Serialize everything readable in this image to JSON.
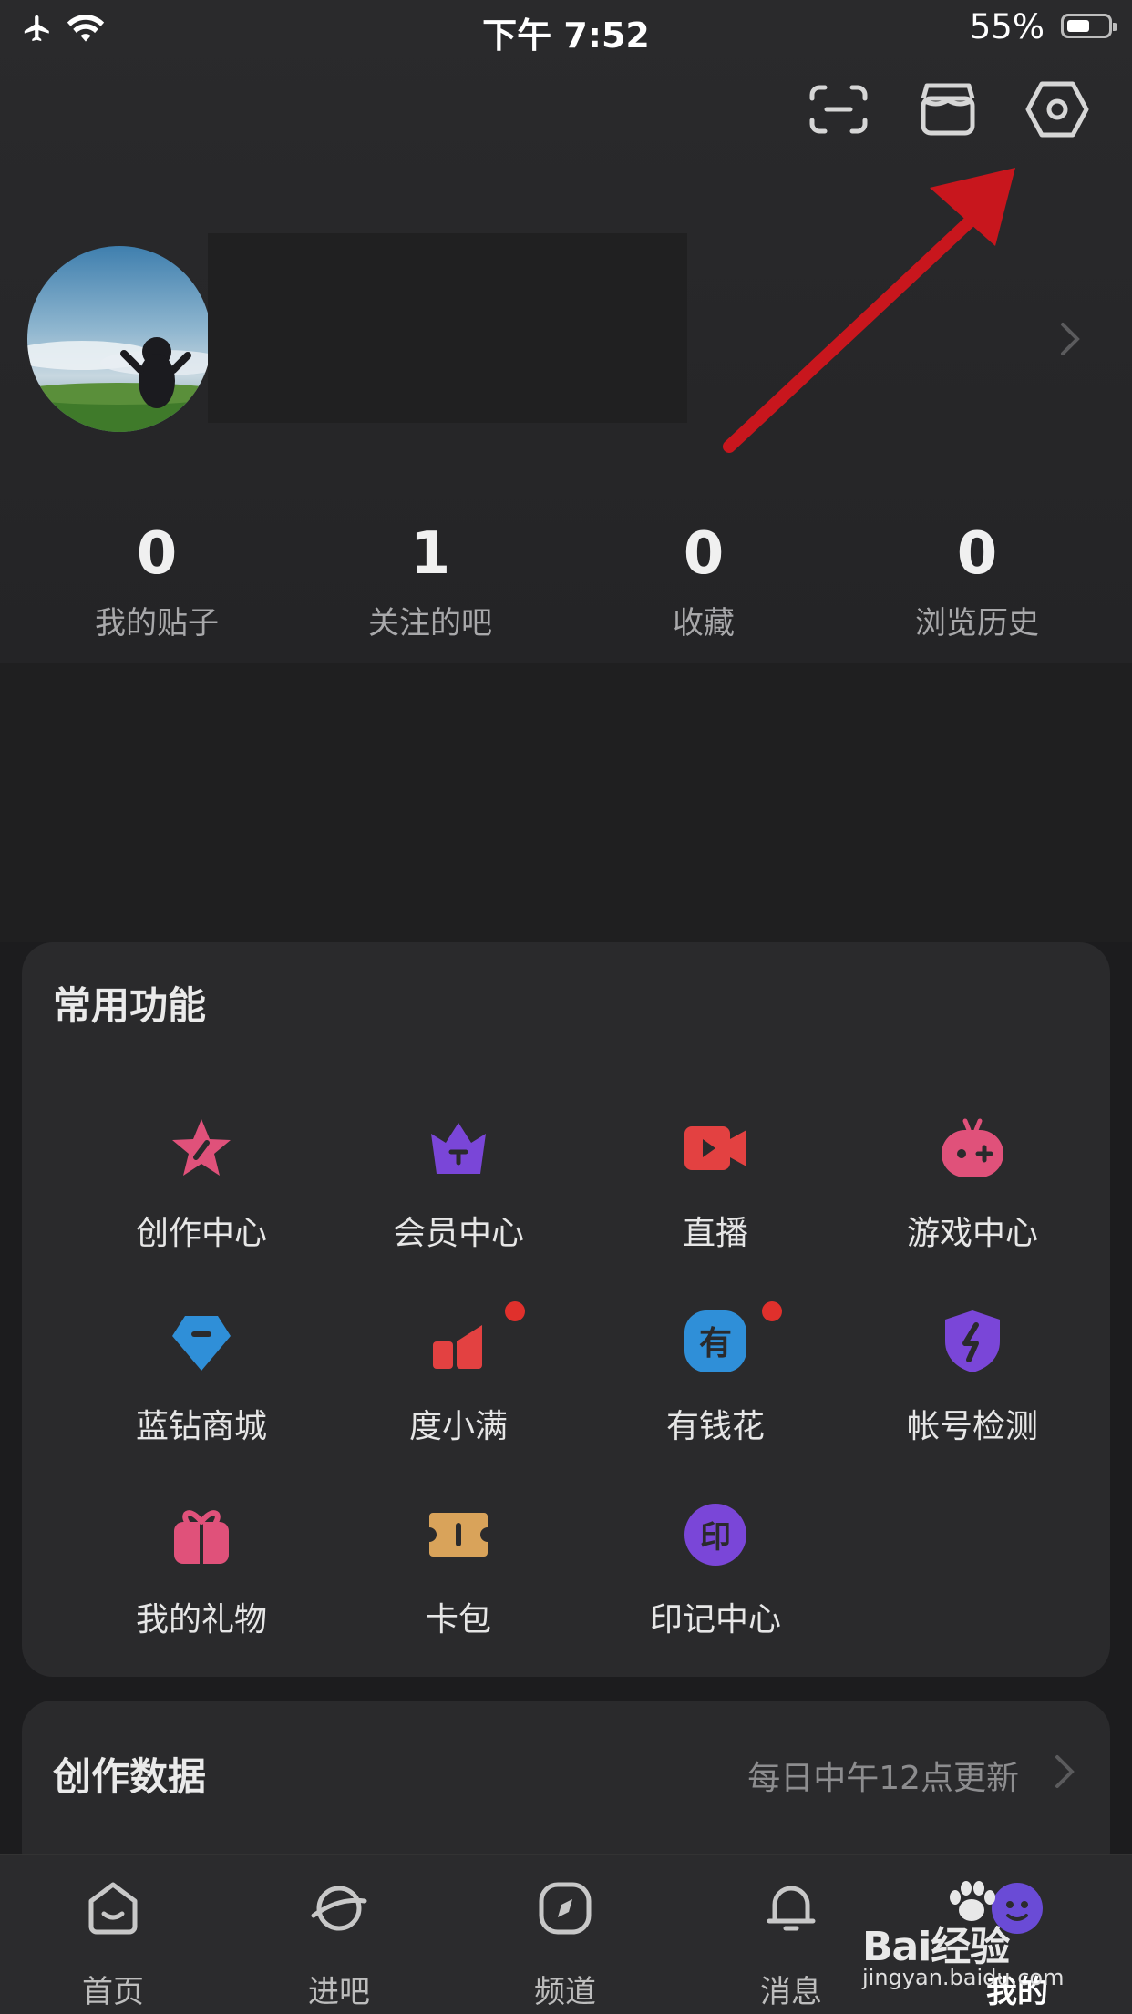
{
  "status_bar": {
    "time": "下午 7:52",
    "battery_percent": "55%",
    "battery_level": 0.55
  },
  "profile": {
    "stats": [
      {
        "value": "0",
        "label": "我的贴子"
      },
      {
        "value": "1",
        "label": "关注的吧"
      },
      {
        "value": "0",
        "label": "收藏"
      },
      {
        "value": "0",
        "label": "浏览历史"
      }
    ]
  },
  "common_functions": {
    "title": "常用功能",
    "items": [
      {
        "label": "创作中心",
        "icon": "star-pen-icon",
        "color": "#e0517a"
      },
      {
        "label": "会员中心",
        "icon": "crown-icon",
        "color": "#7a46d8"
      },
      {
        "label": "直播",
        "icon": "video-camera-icon",
        "color": "#e34141"
      },
      {
        "label": "游戏中心",
        "icon": "gamepad-icon",
        "color": "#e0517a"
      },
      {
        "label": "蓝钻商城",
        "icon": "diamond-icon",
        "color": "#2f8fd8"
      },
      {
        "label": "度小满",
        "icon": "finance-chart-icon",
        "color": "#e34141"
      },
      {
        "label": "有钱花",
        "icon": "money-icon",
        "color": "#2f8fd8"
      },
      {
        "label": "帐号检测",
        "icon": "shield-icon",
        "color": "#7a46d8"
      },
      {
        "label": "我的礼物",
        "icon": "gift-icon",
        "color": "#e0517a"
      },
      {
        "label": "卡包",
        "icon": "ticket-icon",
        "color": "#d9a35a"
      },
      {
        "label": "印记中心",
        "icon": "seal-icon",
        "color": "#7a46d8"
      }
    ],
    "money_icon_glyph": "有",
    "seal_icon_glyph": "印"
  },
  "creation_data": {
    "title": "创作数据",
    "update_note": "每日中午12点更新"
  },
  "tab_bar": [
    {
      "label": "首页",
      "icon": "home-icon"
    },
    {
      "label": "进吧",
      "icon": "planet-icon"
    },
    {
      "label": "频道",
      "icon": "compass-icon"
    },
    {
      "label": "消息",
      "icon": "bell-icon"
    },
    {
      "label": "我的",
      "icon": "profile-icon",
      "active": true
    }
  ],
  "watermark": {
    "brand": "Bai经验",
    "url": "jingyan.baidu.com"
  },
  "colors": {
    "annotation_arrow": "#c8161d",
    "red_dot": "#e0302c"
  }
}
